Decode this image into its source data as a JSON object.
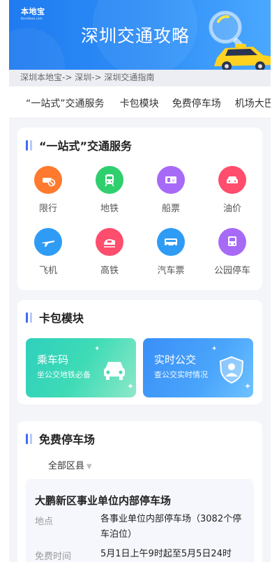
{
  "banner": {
    "logo_main": "本地宝",
    "logo_sub": "Bendibao.com",
    "title": "深圳交通攻略"
  },
  "breadcrumb": "深圳本地宝-> 深圳-> 深圳交通指南",
  "tabs": [
    "“一站式”交通服务",
    "卡包模块",
    "免费停车场",
    "机场大巴"
  ],
  "services": {
    "title": "“一站式”交通服务",
    "items": [
      {
        "label": "限行",
        "icon": "restricted-car-icon",
        "color": "#ff7a2e"
      },
      {
        "label": "地铁",
        "icon": "metro-icon",
        "color": "#2fcf6d"
      },
      {
        "label": "船票",
        "icon": "boat-ticket-icon",
        "color": "#a76af7"
      },
      {
        "label": "油价",
        "icon": "car-icon",
        "color": "#ff4d6d"
      },
      {
        "label": "飞机",
        "icon": "plane-icon",
        "color": "#2e9cf5"
      },
      {
        "label": "高铁",
        "icon": "train-icon",
        "color": "#ff4d6d"
      },
      {
        "label": "汽车票",
        "icon": "bus-icon",
        "color": "#2e9cf5"
      },
      {
        "label": "公园停车",
        "icon": "park-bus-icon",
        "color": "#a76af7"
      }
    ]
  },
  "wallet": {
    "title": "卡包模块",
    "cards": [
      {
        "title": "乘车码",
        "sub": "坐公交地铁必备",
        "icon": "car-front-icon"
      },
      {
        "title": "实时公交",
        "sub": "查公交实时情况",
        "icon": "shield-person-icon"
      }
    ]
  },
  "parking": {
    "title": "免费停车场",
    "filter": "全部区县",
    "item": {
      "name": "大鹏新区事业单位内部停车场",
      "location_key": "地点",
      "location_val": "各事业单位内部停车场（3082个停车泊位）",
      "time_key": "免费时间",
      "time_val": "5月1日上午9时起至5月5日24时"
    }
  }
}
